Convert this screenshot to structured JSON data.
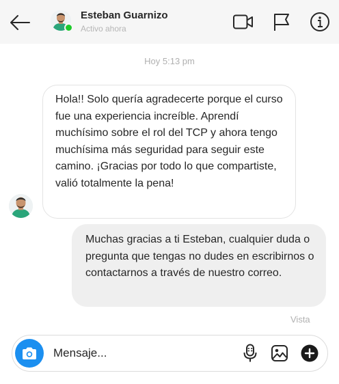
{
  "header": {
    "contact_name": "Esteban Guarnizo",
    "status": "Activo ahora",
    "back_icon": "arrow-left-icon",
    "video_icon": "video-camera-icon",
    "report_icon": "flag-icon",
    "info_icon": "info-icon",
    "online_color": "#1ecb2c"
  },
  "conversation": {
    "timestamp": "Hoy 5:13 pm",
    "messages": [
      {
        "direction": "incoming",
        "text": "Hola!! Solo quería agradecerte porque el curso fue una experiencia increíble. Aprendí muchísimo sobre el rol del TCP y ahora tengo muchísima más seguridad para seguir este camino. ¡Gracias por todo lo que compartiste, valió totalmente la pena!"
      },
      {
        "direction": "outgoing",
        "text": "Muchas gracias a ti Esteban, cualquier duda o pregunta que tengas no dudes en escribirnos o contactarnos a través de nuestro correo."
      }
    ],
    "seen_label": "Vista"
  },
  "composer": {
    "placeholder": "Mensaje...",
    "camera_icon": "camera-icon",
    "mic_icon": "microphone-icon",
    "gallery_icon": "image-icon",
    "add_icon": "plus-circle-icon",
    "accent_color": "#1b8ff0"
  }
}
